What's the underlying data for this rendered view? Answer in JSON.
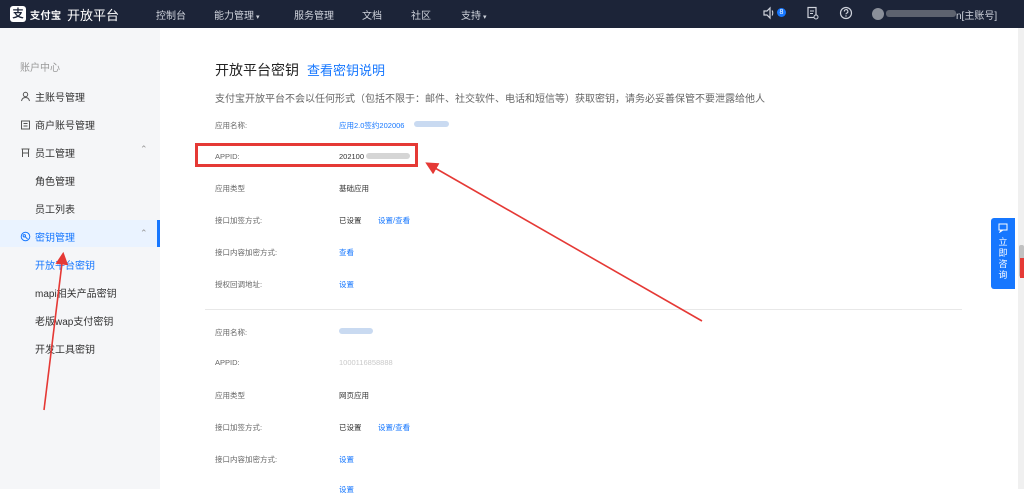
{
  "topbar": {
    "logo_mark": "支",
    "logo_text": "支付宝",
    "title": "开放平台",
    "nav": [
      {
        "label": "控制台"
      },
      {
        "label": "能力管理",
        "caret": true
      },
      {
        "label": "服务管理"
      },
      {
        "label": "文档"
      },
      {
        "label": "社区"
      },
      {
        "label": "支持",
        "caret": true
      }
    ],
    "badge_count": "8",
    "user_suffix": "n[主账号]"
  },
  "sidebar": {
    "header": "账户中心",
    "main_account": "主账号管理",
    "merchant_account": "商户账号管理",
    "staff": "员工管理",
    "role": "角色管理",
    "staff_list": "员工列表",
    "key_mgmt": "密钥管理",
    "open_key": "开放平台密钥",
    "mapi_key": "mapi相关产品密钥",
    "wap_key": "老版wap支付密钥",
    "dev_key": "开发工具密钥"
  },
  "main": {
    "title": "开放平台密钥",
    "doc_link": "查看密钥说明",
    "notice": "支付宝开放平台不会以任何形式（包括不限于：邮件、社交软件、电话和短信等）获取密钥，请务必妥善保管不要泄露给他人",
    "app1": {
      "name_label": "应用名称:",
      "name_value": "应用2.0签约202006",
      "appid_label": "APPID:",
      "appid_value": "202100",
      "type_label": "应用类型",
      "type_value": "基础应用",
      "sign_label": "接口加签方式:",
      "sign_value": "已设置",
      "sign_link": "设置/查看",
      "encrypt_label": "接口内容加密方式:",
      "encrypt_link": "查看",
      "gateway_label": "授权回调地址:",
      "gateway_link": "设置"
    },
    "app2": {
      "name_label": "应用名称:",
      "appid_label": "APPID:",
      "appid_value": "1000116858888",
      "type_label": "应用类型",
      "type_value": "网页应用",
      "sign_label": "接口加签方式:",
      "sign_value": "已设置",
      "sign_link": "设置/查看",
      "encrypt_label": "接口内容加密方式:",
      "encrypt_link": "设置",
      "gateway_link": "设置"
    }
  },
  "consult": {
    "label": "立即咨询"
  },
  "colors": {
    "nav_bg": "#1c2438",
    "accent": "#1677ff",
    "annotation": "#e53935"
  },
  "icons": [
    "volume-icon",
    "document-icon",
    "help-icon",
    "user-icon",
    "building-icon",
    "group-icon",
    "key-icon",
    "chat-icon"
  ]
}
